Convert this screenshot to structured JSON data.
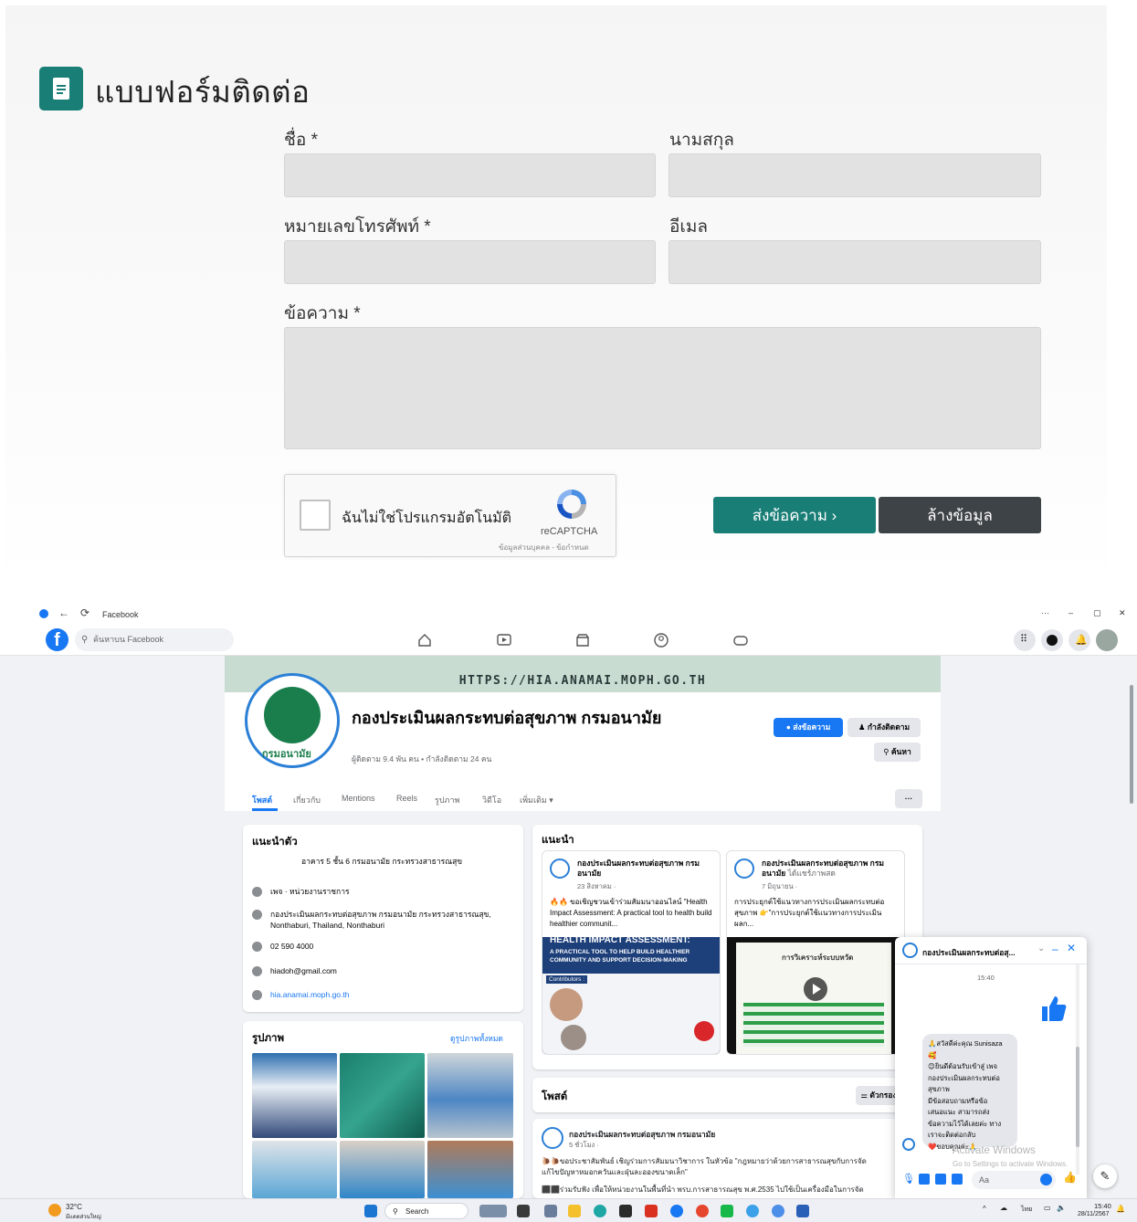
{
  "form": {
    "title": "แบบฟอร์มติดต่อ",
    "first_name_label": "ชื่อ *",
    "last_name_label": "นามสกุล",
    "phone_label": "หมายเลขโทรศัพท์ *",
    "email_label": "อีเมล",
    "message_label": "ข้อความ *",
    "first_name_value": "",
    "last_name_value": "",
    "phone_value": "",
    "email_value": "",
    "message_value": "",
    "captcha_text": "ฉันไม่ใช่โปรแกรมอัตโนมัติ",
    "captcha_brand": "reCAPTCHA",
    "captcha_terms": "ข้อมูลส่วนบุคคล - ข้อกำหนด",
    "send_button": "ส่งข้อความ  ›",
    "clear_button": "ล้างข้อมูล",
    "accent": "#187e76",
    "dark": "#3e4347"
  },
  "browser": {
    "tab_title": "Facebook",
    "window_controls": [
      "···",
      "–",
      "▢",
      "✕"
    ]
  },
  "facebook": {
    "search_placeholder": "ค้นหาบน Facebook",
    "cover_text": "HTTPS://HIA.ANAMAI.MOPH.GO.TH",
    "logo_caption": "กรมอนามัย",
    "page_name": "กองประเมินผลกระทบต่อสุขภาพ กรมอนามัย",
    "stats": "ผู้ติดตาม 9.4 พัน คน • กำลังติดตาม 24 คน",
    "message_button": "ส่งข้อความ",
    "following_button": "กำลังติดตาม",
    "search_button": "ค้นหา",
    "more_button": "···",
    "tabs": [
      "โพสต์",
      "เกี่ยวกับ",
      "Mentions",
      "Reels",
      "รูปภาพ",
      "วิดีโอ",
      "เพิ่มเติม ▾"
    ],
    "intro": {
      "title": "แนะนำตัว",
      "address_line": "อาคาร 5 ชั้น 6 กรมอนามัย กระทรวงสาธารณสุข",
      "category": "เพจ · หน่วยงานราชการ",
      "location": "กองประเมินผลกระทบต่อสุขภาพ กรมอนามัย กระทรวงสาธารณสุข,",
      "location_2": "Nonthaburi, Thailand, Nonthaburi",
      "phone": "02 590 4000",
      "email": "hiadoh@gmail.com",
      "website": "hia.anamai.moph.go.th"
    },
    "photos": {
      "title": "รูปภาพ",
      "see_all": "ดูรูปภาพทั้งหมด"
    },
    "featured": {
      "title": "แนะนำ",
      "cards": [
        {
          "name": "กองประเมินผลกระทบต่อสุขภาพ กรมอนามัย",
          "date": "23 สิงหาคม ·",
          "body": "🔥🔥 ขอเชิญชวนเข้าร่วมสัมมนาออนไลน์ \"Health Impact Assessment: A practical tool to health build healthier communit...",
          "img_title": "HEALTH IMPACT ASSESSMENT:",
          "img_sub": "A PRACTICAL TOOL TO HELP BUILD HEALTHIER COMMUNITY AND SUPPORT DECISION-MAKING",
          "img_contrib": "Contributors :"
        },
        {
          "name": "กองประเมินผลกระทบต่อสุขภาพ กรมอนามัย",
          "name_suffix": "ได้แชร์ภาพสด",
          "date": "7 มิถุนายน ·",
          "body": "การประยุกต์ใช้แนวทางการประเมินผลกระทบต่อสุขภาพ 👉\"การประยุกต์ใช้แนวทางการประเมินผลก...",
          "img_title": "การวิเคราะห์ระบบหวัด"
        }
      ]
    },
    "posts": {
      "title": "โพสต์",
      "filter_button": "ตัวกรอง",
      "post_name": "กองประเมินผลกระทบต่อสุขภาพ กรมอนามัย",
      "post_date": "5 ชั่วโมง ·",
      "post_line1": "🐌🐌ขอประชาสัมพันธ์ เชิญร่วมการสัมมนาวิชาการ ในหัวข้อ \"กฎหมายว่าด้วยการสาธารณสุขกับการจัด",
      "post_line2": "แก้ไขปัญหาหมอกควันและฝุ่นละอองขนาดเล็ก\"",
      "post_line3": "⬛⬛ร่วมรับฟัง เพื่อให้หน่วยงานในพื้นที่นำ พรบ.การสาธารณสุข พ.ศ.2535 ไปใช้เป็นเครื่องมือในการจัด"
    },
    "chat": {
      "name": "กองประเมินผลกระทบต่อสุ...",
      "time": "15:40",
      "message_lines": [
        "🙏สวัสดีค่ะคุณ Sunisaza",
        "🥰",
        "😊ยินดีต้อนรับเข้าสู่ เพจ",
        "กองประเมินผลกระทบต่อ",
        "สุขภาพ",
        "มีข้อสอบถามหรือข้อ",
        "เสนอแนะ สามารถส่ง",
        "ข้อความไว้ได้เลยค่ะ ทาง",
        "เราจะติดต่อกลับ",
        "❤️ขอบคุณค่ะ🙏"
      ],
      "input_placeholder": "Aa"
    },
    "activate_title": "Activate Windows",
    "activate_sub": "Go to Settings to activate Windows."
  },
  "taskbar": {
    "weather_temp": "32°C",
    "weather_desc": "มีแดดส่วนใหญ่",
    "search": "Search",
    "lang": "ไทย",
    "time": "15:40",
    "date": "28/11/2567"
  }
}
